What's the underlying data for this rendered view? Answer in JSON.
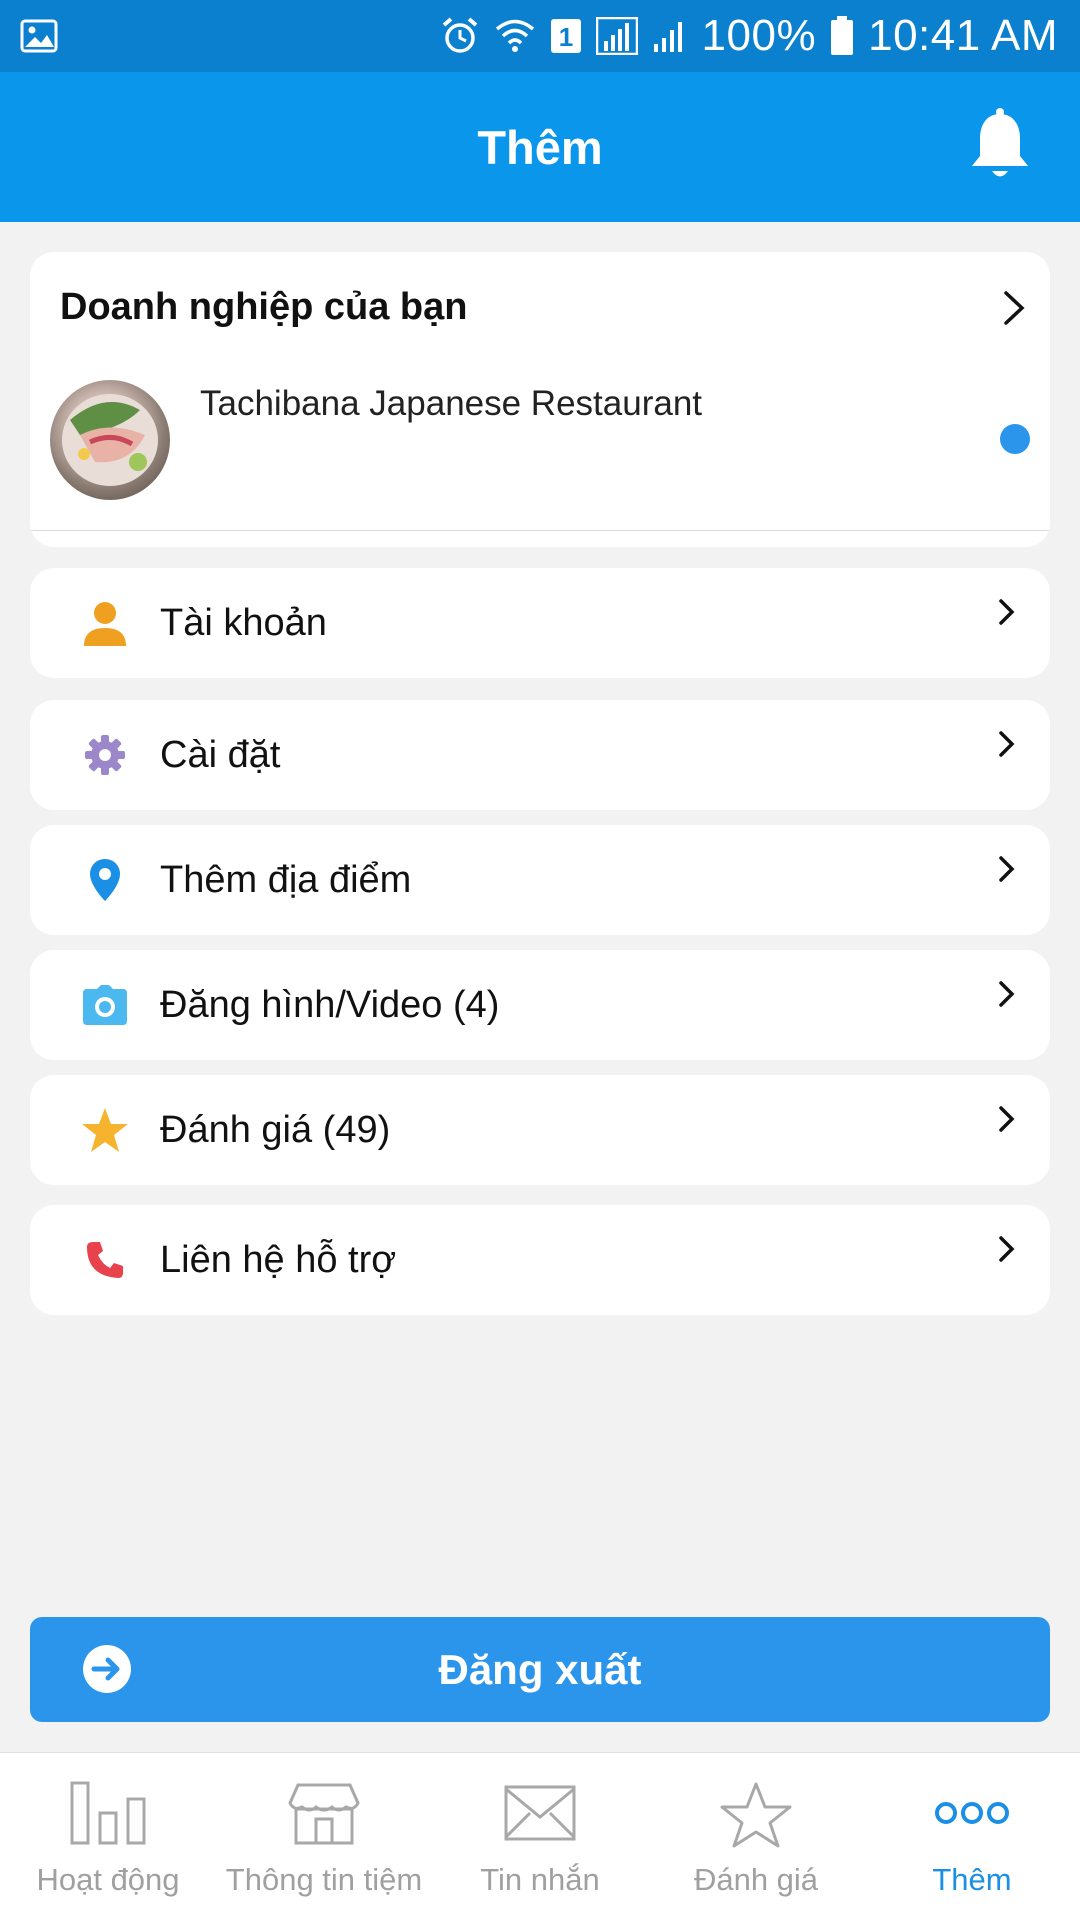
{
  "status_bar": {
    "battery": "100%",
    "time": "10:41 AM",
    "sim_badge": "1"
  },
  "header": {
    "title": "Thêm"
  },
  "business": {
    "section_title": "Doanh nghiệp của bạn",
    "restaurant_name": "Tachibana Japanese Restaurant"
  },
  "menu": {
    "items": [
      {
        "label": "Tài khoản",
        "icon": "person-icon",
        "color": "#f0a020"
      },
      {
        "label": "Cài đặt",
        "icon": "gear-icon",
        "color": "#9b87c9"
      },
      {
        "label": "Thêm địa điểm",
        "icon": "location-pin-icon",
        "color": "#1b8fe6"
      },
      {
        "label": "Đăng hình/Video (4)",
        "icon": "camera-icon",
        "color": "#4cb8f0"
      },
      {
        "label": "Đánh giá (49)",
        "icon": "star-icon",
        "color": "#f5b32e"
      },
      {
        "label": "Liên hệ hỗ trợ",
        "icon": "phone-icon",
        "color": "#e8434d"
      }
    ]
  },
  "logout": {
    "label": "Đăng xuất"
  },
  "bottom_nav": {
    "items": [
      {
        "label": "Hoạt động",
        "icon": "bar-chart-icon"
      },
      {
        "label": "Thông tin tiệm",
        "icon": "storefront-icon"
      },
      {
        "label": "Tin nhắn",
        "icon": "envelope-icon"
      },
      {
        "label": "Đánh giá",
        "icon": "star-outline-icon"
      },
      {
        "label": "Thêm",
        "icon": "more-dots-icon",
        "active": true
      }
    ]
  },
  "colors": {
    "status_bar": "#0a80cf",
    "header": "#0a96ea",
    "accent": "#2a95eb",
    "background": "#f2f2f2"
  }
}
